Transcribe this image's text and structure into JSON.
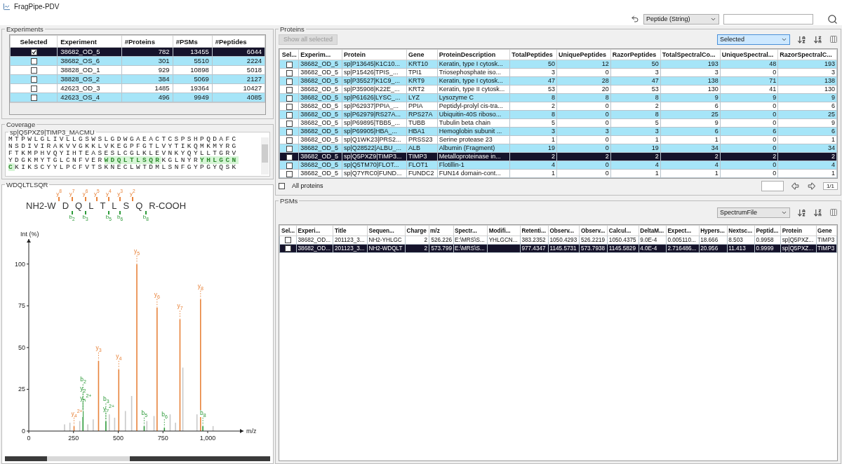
{
  "window": {
    "title": "FragPipe-PDV"
  },
  "search_bar": {
    "field_type": "Peptide (String)"
  },
  "experiments": {
    "title": "Experiments",
    "checkbox_column": "Selected",
    "columns": [
      {
        "label": "Experiment"
      },
      {
        "label": "#Proteins"
      },
      {
        "label": "#PSMs"
      },
      {
        "label": "#Peptides"
      }
    ],
    "rows": [
      {
        "checked": true,
        "selected": true,
        "cells": [
          "38682_OD_5",
          "782",
          "13455",
          "6044"
        ]
      },
      {
        "checked": false,
        "selected": false,
        "cells": [
          "38682_OS_6",
          "301",
          "5510",
          "2224"
        ]
      },
      {
        "checked": false,
        "selected": false,
        "cells": [
          "38828_OD_1",
          "929",
          "10898",
          "5018"
        ]
      },
      {
        "checked": false,
        "selected": false,
        "cells": [
          "38828_OS_2",
          "384",
          "5069",
          "2127"
        ]
      },
      {
        "checked": false,
        "selected": false,
        "cells": [
          "42623_OD_3",
          "1485",
          "19364",
          "10427"
        ]
      },
      {
        "checked": false,
        "selected": false,
        "cells": [
          "42623_OS_4",
          "496",
          "9949",
          "4085"
        ]
      }
    ]
  },
  "coverage": {
    "title": "Coverage",
    "protein": "sp|Q5PXZ9|TIMP3_MACMU",
    "lines": [
      [
        {
          "text": "MTPWLGLIVLLGSWSLGDWGAEACTCSPSHPQDAFC",
          "covered": false
        }
      ],
      [
        {
          "text": "NSDIVIRAKVVGKKLVKEGPFGTLVYTIKQMKMYRG",
          "covered": false
        }
      ],
      [
        {
          "text": "FTKMPHVQYIHTEASESLCGLKLEVNKYQYLLTGRV",
          "covered": false
        }
      ],
      [
        {
          "text": "YDGKMYTGLCNFVER",
          "covered": false
        },
        {
          "text": "WDQLTLSQR",
          "covered": true
        },
        {
          "text": "KGLNYR",
          "covered": false
        },
        {
          "text": "YHLGCN",
          "covered": true
        }
      ],
      [
        {
          "text": "C",
          "covered": true
        },
        {
          "text": "KIKSCYYLPCFVTSKNECLWTDMLSNFGYPGYQSK",
          "covered": false
        }
      ]
    ]
  },
  "spectrum": {
    "title": "WDQLTLSQR",
    "fragment_map": {
      "n_term": "NH2-",
      "c_term": "-COOH",
      "residues": [
        {
          "aa": "W",
          "y_ion": "y$^{8}$"
        },
        {
          "aa": "D",
          "y_ion": "y$^{7}$",
          "b_ion": "b$_{2}$"
        },
        {
          "aa": "Q",
          "y_ion": "y$^{6}$",
          "b_ion": "b$_{3}$"
        },
        {
          "aa": "L",
          "y_ion": "y$^{5}$"
        },
        {
          "aa": "T",
          "y_ion": "y$^{4}$",
          "b_ion": "b$_{5}$"
        },
        {
          "aa": "L",
          "y_ion": "y$^{3}$",
          "b_ion": "b$_{6}$"
        },
        {
          "aa": "S",
          "y_ion": "y$^{2}$"
        },
        {
          "aa": "Q",
          "b_ion": "b$_{8}$"
        },
        {
          "aa": "R"
        }
      ]
    },
    "chart_data": {
      "type": "bar",
      "xlabel": "m/z",
      "ylabel": "Int (%)",
      "xlim": [
        0,
        1200
      ],
      "ylim": [
        0,
        115
      ],
      "xticks": [
        0,
        250,
        500,
        750,
        {
          "value": 1000,
          "label": "1,000"
        }
      ],
      "yticks": [
        0,
        25,
        50,
        75,
        100
      ],
      "x": [
        200,
        230,
        253,
        285,
        303,
        330,
        360,
        390,
        431,
        450,
        480,
        503,
        540,
        575,
        604,
        645,
        660,
        700,
        717,
        758,
        790,
        820,
        845,
        861,
        940,
        960,
        973,
        1030
      ],
      "series": [
        {
          "color": "#e8843c",
          "values": [
            null,
            null,
            3,
            null,
            null,
            null,
            null,
            42,
            null,
            null,
            null,
            37,
            null,
            null,
            100,
            null,
            null,
            null,
            74,
            null,
            null,
            null,
            67,
            null,
            null,
            79,
            null,
            null
          ]
        },
        {
          "color": "#2e9a3a",
          "values": [
            null,
            null,
            null,
            null,
            12,
            null,
            null,
            null,
            6,
            null,
            null,
            null,
            null,
            null,
            null,
            3,
            null,
            null,
            null,
            2,
            null,
            null,
            null,
            null,
            null,
            null,
            3,
            null
          ]
        },
        {
          "color": "#c8c8c8",
          "values": [
            4,
            5,
            null,
            6,
            null,
            4,
            7,
            null,
            null,
            10,
            8,
            null,
            12,
            21,
            null,
            null,
            6,
            9,
            null,
            null,
            10,
            5,
            null,
            38,
            10,
            null,
            null,
            3
          ]
        }
      ],
      "annotations": [
        {
          "x": 253,
          "y": 3,
          "text": "y$_{4}$$^{2+}$"
        },
        {
          "x": 303,
          "y": 12,
          "text": "y$_{5}$$^{2+}$"
        },
        {
          "x": 303,
          "y": 12,
          "text": "y$_{2}$"
        },
        {
          "x": 303,
          "y": 12,
          "text": "b$_{2}$"
        },
        {
          "x": 390,
          "y": 42,
          "text": "y$_{3}$"
        },
        {
          "x": 431,
          "y": 6,
          "text": "y$_{7}$$^{2+}$"
        },
        {
          "x": 431,
          "y": 6,
          "text": "b$_{3}$"
        },
        {
          "x": 503,
          "y": 37,
          "text": "y$_{4}$"
        },
        {
          "x": 604,
          "y": 100,
          "text": "y$_{5}$"
        },
        {
          "x": 645,
          "y": 3,
          "text": "b$_{5}$"
        },
        {
          "x": 717,
          "y": 74,
          "text": "y$_{6}$"
        },
        {
          "x": 758,
          "y": 2,
          "text": "b$_{6}$"
        },
        {
          "x": 845,
          "y": 67,
          "text": "y$_{7}$"
        },
        {
          "x": 960,
          "y": 79,
          "text": "y$_{8}$"
        },
        {
          "x": 973,
          "y": 3,
          "text": "b$_{8}$"
        }
      ]
    }
  },
  "proteins": {
    "title": "Proteins",
    "show_selected_button": {
      "label": "Show all selected",
      "disabled": true
    },
    "sort_field": "Selected",
    "checkbox_column": "Sel...",
    "columns": [
      {
        "label": "Experim..."
      },
      {
        "label": "Protein"
      },
      {
        "label": "Gene"
      },
      {
        "label": "ProteinDescription"
      },
      {
        "label": "TotalPeptides"
      },
      {
        "label": "UniquePeptides"
      },
      {
        "label": "RazorPeptides"
      },
      {
        "label": "TotalSpectralCo..."
      },
      {
        "label": "UniqueSpectral..."
      },
      {
        "label": "RazorSpectralC..."
      }
    ],
    "rows": [
      {
        "checked": false,
        "selected": false,
        "cells": [
          "38682_OD_5",
          "sp|P13645|K1C10...",
          "KRT10",
          "Keratin, type I cytosk...",
          "50",
          "12",
          "50",
          "193",
          "48",
          "193"
        ]
      },
      {
        "checked": false,
        "selected": false,
        "cells": [
          "38682_OD_5",
          "sp|P15426|TPIS_...",
          "TPI1",
          "Triosephosphate iso...",
          "3",
          "0",
          "3",
          "3",
          "0",
          "3"
        ]
      },
      {
        "checked": false,
        "selected": false,
        "cells": [
          "38682_OD_5",
          "sp|P35527|K1C9_...",
          "KRT9",
          "Keratin, type I cytosk...",
          "47",
          "28",
          "47",
          "138",
          "71",
          "138"
        ]
      },
      {
        "checked": false,
        "selected": false,
        "cells": [
          "38682_OD_5",
          "sp|P35908|K22E_...",
          "KRT2",
          "Keratin, type II cytosk...",
          "53",
          "20",
          "53",
          "130",
          "41",
          "130"
        ]
      },
      {
        "checked": false,
        "selected": false,
        "cells": [
          "38682_OD_5",
          "sp|P61626|LYSC_...",
          "LYZ",
          "Lysozyme C",
          "8",
          "8",
          "8",
          "9",
          "9",
          "9"
        ]
      },
      {
        "checked": false,
        "selected": false,
        "cells": [
          "38682_OD_5",
          "sp|P62937|PPIA_...",
          "PPIA",
          "Peptidyl-prolyl cis-tra...",
          "2",
          "0",
          "2",
          "6",
          "0",
          "6"
        ]
      },
      {
        "checked": false,
        "selected": false,
        "cells": [
          "38682_OD_5",
          "sp|P62979|RS27A...",
          "RPS27A",
          "Ubiquitin-40S riboso...",
          "8",
          "0",
          "8",
          "25",
          "0",
          "25"
        ]
      },
      {
        "checked": false,
        "selected": false,
        "cells": [
          "38682_OD_5",
          "sp|P69895|TBB5_...",
          "TUBB",
          "Tubulin beta chain",
          "5",
          "0",
          "5",
          "9",
          "0",
          "9"
        ]
      },
      {
        "checked": false,
        "selected": false,
        "cells": [
          "38682_OD_5",
          "sp|P69905|HBA_...",
          "HBA1",
          "Hemoglobin subunit ...",
          "3",
          "3",
          "3",
          "6",
          "6",
          "6"
        ]
      },
      {
        "checked": false,
        "selected": false,
        "cells": [
          "38682_OD_5",
          "sp|Q1WK23|PRS2...",
          "PRSS23",
          "Serine protease 23",
          "1",
          "0",
          "1",
          "1",
          "0",
          "1"
        ]
      },
      {
        "checked": false,
        "selected": false,
        "cells": [
          "38682_OD_5",
          "sp|Q28522|ALBU_...",
          "ALB",
          "Albumin (Fragment)",
          "19",
          "0",
          "19",
          "34",
          "0",
          "34"
        ]
      },
      {
        "checked": false,
        "selected": true,
        "cells": [
          "38682_OD_5",
          "sp|Q5PXZ9|TIMP3...",
          "TIMP3",
          "Metalloproteinase in...",
          "2",
          "2",
          "2",
          "2",
          "2",
          "2"
        ]
      },
      {
        "checked": false,
        "selected": false,
        "cells": [
          "38682_OD_5",
          "sp|Q5TM70|FLOT...",
          "FLOT1",
          "Flotillin-1",
          "4",
          "0",
          "4",
          "4",
          "0",
          "4"
        ]
      },
      {
        "checked": false,
        "selected": false,
        "cells": [
          "38682_OD_5",
          "sp|Q7YRC0|FUND...",
          "FUNDC2",
          "FUN14 domain-cont...",
          "1",
          "0",
          "1",
          "1",
          "0",
          "1"
        ]
      }
    ],
    "all_proteins": {
      "label": "All proteins",
      "checked": false
    },
    "page": "1/1"
  },
  "psms": {
    "title": "PSMs",
    "sort_field": "SpectrumFile",
    "checkbox_column": "Sel...",
    "columns": [
      {
        "label": "Experi..."
      },
      {
        "label": "Title"
      },
      {
        "label": "Sequen..."
      },
      {
        "label": "Charge"
      },
      {
        "label": "m/z"
      },
      {
        "label": "Spectr..."
      },
      {
        "label": "Modifi..."
      },
      {
        "label": "Retenti..."
      },
      {
        "label": "Observ..."
      },
      {
        "label": "Observ..."
      },
      {
        "label": "Calcul..."
      },
      {
        "label": "DeltaM..."
      },
      {
        "label": "Expect..."
      },
      {
        "label": "Hypers..."
      },
      {
        "label": "Nextsc..."
      },
      {
        "label": "Peptid..."
      },
      {
        "label": "Protein"
      },
      {
        "label": "Gene"
      }
    ],
    "rows": [
      {
        "checked": false,
        "selected": false,
        "cells": [
          "38682_OD...",
          "201123_3...",
          "NH2-YHLGC",
          "2",
          "526.226",
          "E:\\MRS\\S...",
          "YHLGCN...",
          "383.2352",
          "1050.4293",
          "526.2219",
          "1050.4375",
          "9.0E-4",
          "0.005110...",
          "18.666",
          "8.503",
          "0.9958",
          "sp|Q5PXZ...",
          "TIMP3"
        ]
      },
      {
        "checked": false,
        "selected": true,
        "cells": [
          "38682_OD...",
          "201123_3...",
          "NH2-WDQLT",
          "2",
          "573.799",
          "E:\\MRS\\S...",
          null,
          "977.4347",
          "1145.5731",
          "573.7938",
          "1145.5829",
          "4.0E-4",
          "2.716486...",
          "20.956",
          "11.413",
          "0.9999",
          "sp|Q5PXZ...",
          "TIMP3"
        ]
      }
    ]
  }
}
